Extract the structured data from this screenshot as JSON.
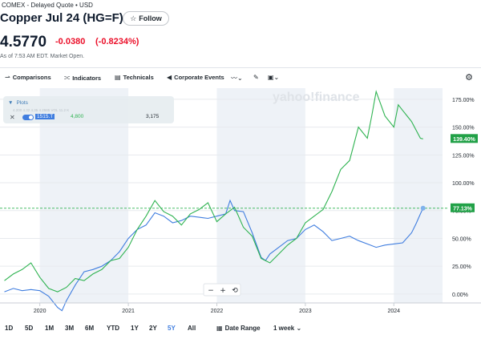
{
  "header": {
    "exchange_line": "COMEX - Delayed Quote • USD",
    "title": "Copper Jul 24 (HG=F)",
    "follow_label": "Follow",
    "price": "4.5770",
    "change": "-0.0380",
    "change_pct": "(-0.8234%)",
    "as_of": "As of 7:53 AM EDT. Market Open."
  },
  "toolbar": {
    "comparisons": "Comparisons",
    "indicators": "Indicators",
    "technicals": "Technicals",
    "corporate_events": "Corporate Events",
    "icons": [
      "comparisons-icon",
      "indicators-icon",
      "technicals-icon",
      "corporate-events-icon",
      "line-chart-icon",
      "pencil-icon",
      "chart-type-icon",
      "settings-icon"
    ]
  },
  "plots": {
    "title": "Plots",
    "faint_line": "4.200   4.32   4.35   4.2585   VOL   11.2 K",
    "symbol": "1515.T",
    "value1": "4,800",
    "value2": "3,175"
  },
  "watermark": "yahoo!finance",
  "zoom": {
    "minus": "−",
    "plus": "+",
    "reset": "⟲"
  },
  "badges": {
    "green": "139.40%",
    "blue": "77.13%"
  },
  "chart_data": {
    "type": "line",
    "x_ticks": [
      "2020",
      "2021",
      "2022",
      "2023",
      "2024"
    ],
    "y_ticks": [
      "0.00%",
      "25.00%",
      "50.00%",
      "75.00%",
      "100.00%",
      "125.00%",
      "150.00%",
      "175.00%"
    ],
    "ylim": [
      -8,
      185
    ],
    "grid": true,
    "series": [
      {
        "name": "HG=F",
        "color": "#3f7ddf",
        "x": [
          2019.6,
          2019.7,
          2019.8,
          2019.9,
          2020.0,
          2020.1,
          2020.2,
          2020.25,
          2020.3,
          2020.4,
          2020.5,
          2020.6,
          2020.7,
          2020.8,
          2020.9,
          2021.0,
          2021.1,
          2021.2,
          2021.3,
          2021.4,
          2021.5,
          2021.6,
          2021.7,
          2021.8,
          2021.9,
          2022.0,
          2022.1,
          2022.15,
          2022.2,
          2022.3,
          2022.4,
          2022.5,
          2022.55,
          2022.6,
          2022.7,
          2022.8,
          2022.9,
          2023.0,
          2023.1,
          2023.2,
          2023.3,
          2023.4,
          2023.5,
          2023.6,
          2023.7,
          2023.8,
          2023.9,
          2024.0,
          2024.1,
          2024.2,
          2024.25,
          2024.3,
          2024.33
        ],
        "y": [
          2,
          5,
          3,
          4,
          3,
          -2,
          -12,
          -15,
          -6,
          8,
          20,
          22,
          25,
          30,
          38,
          50,
          58,
          62,
          73,
          70,
          64,
          66,
          70,
          69,
          68,
          70,
          72,
          84,
          75,
          74,
          55,
          33,
          30,
          36,
          42,
          48,
          50,
          58,
          62,
          56,
          48,
          50,
          52,
          48,
          45,
          42,
          44,
          45,
          46,
          55,
          63,
          72,
          77.13
        ]
      },
      {
        "name": "1515.T",
        "color": "#2fb351",
        "x": [
          2019.6,
          2019.7,
          2019.8,
          2019.9,
          2020.0,
          2020.1,
          2020.2,
          2020.3,
          2020.4,
          2020.5,
          2020.6,
          2020.7,
          2020.8,
          2020.9,
          2021.0,
          2021.1,
          2021.2,
          2021.3,
          2021.4,
          2021.5,
          2021.6,
          2021.7,
          2021.8,
          2021.9,
          2022.0,
          2022.1,
          2022.2,
          2022.3,
          2022.4,
          2022.5,
          2022.6,
          2022.7,
          2022.8,
          2022.9,
          2023.0,
          2023.1,
          2023.2,
          2023.3,
          2023.4,
          2023.5,
          2023.6,
          2023.7,
          2023.75,
          2023.8,
          2023.9,
          2024.0,
          2024.05,
          2024.1,
          2024.2,
          2024.3,
          2024.33
        ],
        "y": [
          12,
          18,
          22,
          28,
          15,
          5,
          2,
          6,
          14,
          12,
          18,
          22,
          30,
          32,
          42,
          58,
          70,
          84,
          74,
          70,
          62,
          72,
          76,
          82,
          65,
          72,
          78,
          60,
          52,
          32,
          28,
          36,
          44,
          50,
          64,
          70,
          76,
          92,
          112,
          120,
          150,
          140,
          160,
          182,
          160,
          150,
          170,
          165,
          155,
          140,
          139.4
        ]
      }
    ]
  },
  "range_bar": {
    "buttons": [
      "1D",
      "5D",
      "1M",
      "3M",
      "6M",
      "YTD",
      "1Y",
      "2Y",
      "5Y",
      "All"
    ],
    "active": "5Y",
    "date_range": "Date Range",
    "interval": "1 week"
  }
}
